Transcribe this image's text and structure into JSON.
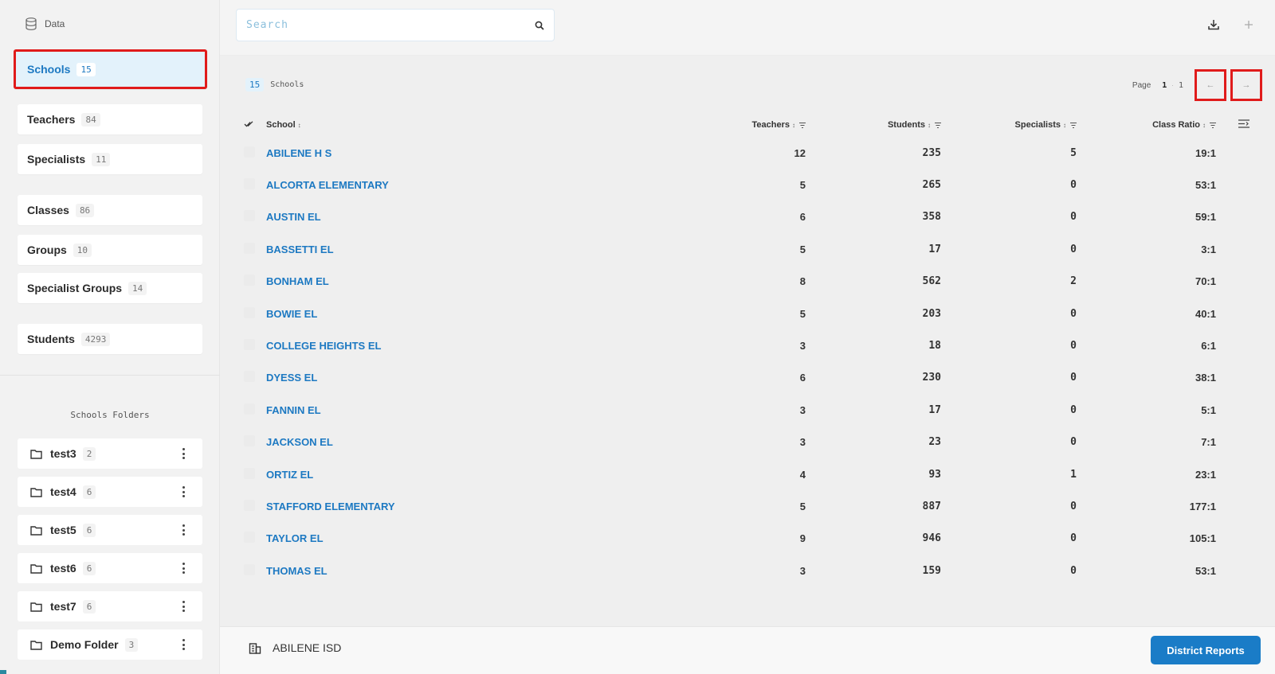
{
  "sidebar": {
    "header": "Data",
    "nav": [
      {
        "label": "Schools",
        "count": "15"
      },
      {
        "label": "Teachers",
        "count": "84"
      },
      {
        "label": "Specialists",
        "count": "11"
      },
      {
        "label": "Classes",
        "count": "86"
      },
      {
        "label": "Groups",
        "count": "10"
      },
      {
        "label": "Specialist Groups",
        "count": "14"
      },
      {
        "label": "Students",
        "count": "4293"
      }
    ],
    "folders_title": "Schools Folders",
    "folders": [
      {
        "label": "test3",
        "count": "2"
      },
      {
        "label": "test4",
        "count": "6"
      },
      {
        "label": "test5",
        "count": "6"
      },
      {
        "label": "test6",
        "count": "6"
      },
      {
        "label": "test7",
        "count": "6"
      },
      {
        "label": "Demo Folder",
        "count": "3"
      }
    ]
  },
  "search": {
    "placeholder": "Search"
  },
  "summary": {
    "count": "15",
    "label": "Schools"
  },
  "pager": {
    "label": "Page",
    "current": "1",
    "total": "1",
    "prev": "←",
    "next": "→"
  },
  "table": {
    "headers": {
      "school": "School",
      "teachers": "Teachers",
      "students": "Students",
      "specialists": "Specialists",
      "ratio": "Class Ratio"
    },
    "rows": [
      {
        "school": "ABILENE H S",
        "teachers": "12",
        "students": "235",
        "specialists": "5",
        "ratio": "19:1"
      },
      {
        "school": "ALCORTA ELEMENTARY",
        "teachers": "5",
        "students": "265",
        "specialists": "0",
        "ratio": "53:1"
      },
      {
        "school": "AUSTIN EL",
        "teachers": "6",
        "students": "358",
        "specialists": "0",
        "ratio": "59:1"
      },
      {
        "school": "BASSETTI EL",
        "teachers": "5",
        "students": "17",
        "specialists": "0",
        "ratio": "3:1"
      },
      {
        "school": "BONHAM EL",
        "teachers": "8",
        "students": "562",
        "specialists": "2",
        "ratio": "70:1"
      },
      {
        "school": "BOWIE EL",
        "teachers": "5",
        "students": "203",
        "specialists": "0",
        "ratio": "40:1"
      },
      {
        "school": "COLLEGE HEIGHTS EL",
        "teachers": "3",
        "students": "18",
        "specialists": "0",
        "ratio": "6:1"
      },
      {
        "school": "DYESS EL",
        "teachers": "6",
        "students": "230",
        "specialists": "0",
        "ratio": "38:1"
      },
      {
        "school": "FANNIN EL",
        "teachers": "3",
        "students": "17",
        "specialists": "0",
        "ratio": "5:1"
      },
      {
        "school": "JACKSON EL",
        "teachers": "3",
        "students": "23",
        "specialists": "0",
        "ratio": "7:1"
      },
      {
        "school": "ORTIZ EL",
        "teachers": "4",
        "students": "93",
        "specialists": "1",
        "ratio": "23:1"
      },
      {
        "school": "STAFFORD ELEMENTARY",
        "teachers": "5",
        "students": "887",
        "specialists": "0",
        "ratio": "177:1"
      },
      {
        "school": "TAYLOR EL",
        "teachers": "9",
        "students": "946",
        "specialists": "0",
        "ratio": "105:1"
      },
      {
        "school": "THOMAS EL",
        "teachers": "3",
        "students": "159",
        "specialists": "0",
        "ratio": "53:1"
      }
    ]
  },
  "footer": {
    "district": "ABILENE ISD",
    "reports_button": "District Reports"
  },
  "colors": {
    "accent": "#1d79c2",
    "highlight": "#e01b1b",
    "button": "#1a7cc7"
  }
}
